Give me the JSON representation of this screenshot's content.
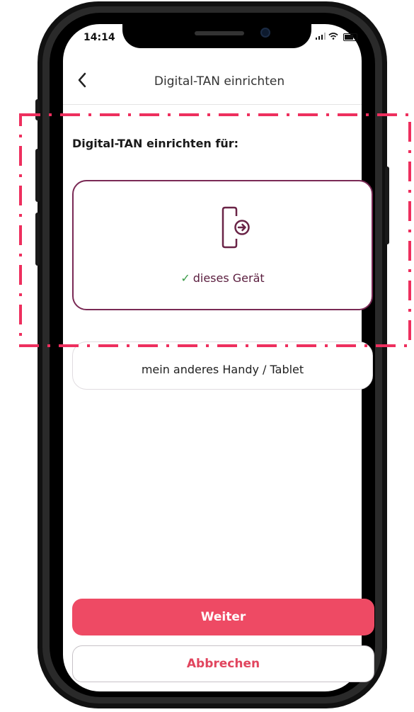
{
  "status_bar": {
    "time": "14:14"
  },
  "nav": {
    "title": "Digital-TAN einrichten",
    "back_icon": "chevron-left-icon"
  },
  "content": {
    "heading": "Digital-TAN einrichten für:",
    "options": [
      {
        "label": "dieses Gerät",
        "selected": true,
        "icon": "device-arrow-icon"
      },
      {
        "label": "mein anderes Handy / Tablet",
        "selected": false
      }
    ]
  },
  "buttons": {
    "continue": "Weiter",
    "cancel": "Abbrechen"
  },
  "colors": {
    "accent": "#ee4a64",
    "selected_border": "#7a2a55",
    "check": "#3a9b47",
    "highlight_dash": "#ee2f5e"
  }
}
